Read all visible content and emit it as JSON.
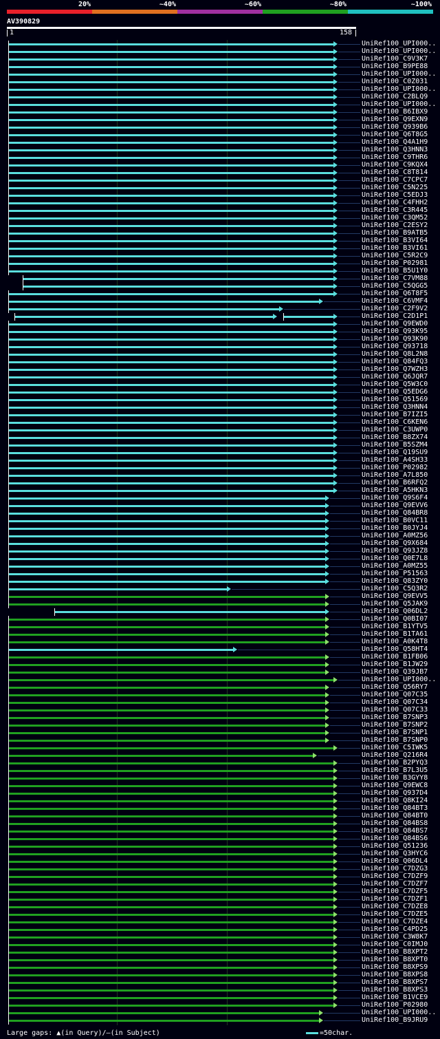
{
  "legend": {
    "labels": [
      "20%",
      "~40%",
      "~60%",
      "~80%",
      "~100%"
    ],
    "colors": [
      "#e8202a",
      "#e07020",
      "#a030a0",
      "#20a020",
      "#20c0c0"
    ]
  },
  "query": {
    "name": "AV390829",
    "start": "1",
    "end": "158",
    "length": 158
  },
  "footer": {
    "gaps_label": "Large gaps:",
    "gaps_query": "(in Query)/",
    "gaps_subject": "(in Subject)",
    "scale_label": "=50char."
  },
  "colors": {
    "cyan": "#5adede",
    "green": "#20a020",
    "background": "#000010"
  },
  "hits": [
    {
      "label": "UniRef100_UPI000..",
      "start": 1,
      "end": 158,
      "color": "cyan"
    },
    {
      "label": "UniRef100_UPI000..",
      "start": 1,
      "end": 158,
      "color": "cyan"
    },
    {
      "label": "UniRef100_C9V3K7",
      "start": 1,
      "end": 158,
      "color": "cyan"
    },
    {
      "label": "UniRef100_B9PE88",
      "start": 1,
      "end": 158,
      "color": "cyan"
    },
    {
      "label": "UniRef100_UPI000..",
      "start": 1,
      "end": 158,
      "color": "cyan"
    },
    {
      "label": "UniRef100_C0Z031",
      "start": 1,
      "end": 158,
      "color": "cyan"
    },
    {
      "label": "UniRef100_UPI000..",
      "start": 1,
      "end": 158,
      "color": "cyan"
    },
    {
      "label": "UniRef100_C2BLQ9",
      "start": 1,
      "end": 158,
      "color": "cyan"
    },
    {
      "label": "UniRef100_UPI000..",
      "start": 1,
      "end": 158,
      "color": "cyan"
    },
    {
      "label": "UniRef100_B6IBX9",
      "start": 1,
      "end": 158,
      "color": "cyan"
    },
    {
      "label": "UniRef100_Q9EXN9",
      "start": 1,
      "end": 158,
      "color": "cyan"
    },
    {
      "label": "UniRef100_Q939B6",
      "start": 1,
      "end": 158,
      "color": "cyan"
    },
    {
      "label": "UniRef100_Q6T8G5",
      "start": 1,
      "end": 158,
      "color": "cyan"
    },
    {
      "label": "UniRef100_Q4A1H9",
      "start": 1,
      "end": 158,
      "color": "cyan"
    },
    {
      "label": "UniRef100_Q3HNN3",
      "start": 1,
      "end": 158,
      "color": "cyan"
    },
    {
      "label": "UniRef100_C9THR6",
      "start": 1,
      "end": 158,
      "color": "cyan"
    },
    {
      "label": "UniRef100_C9KQX4",
      "start": 1,
      "end": 158,
      "color": "cyan"
    },
    {
      "label": "UniRef100_C8T814",
      "start": 1,
      "end": 158,
      "color": "cyan"
    },
    {
      "label": "UniRef100_C7CPC7",
      "start": 1,
      "end": 158,
      "color": "cyan"
    },
    {
      "label": "UniRef100_C5N225",
      "start": 1,
      "end": 158,
      "color": "cyan"
    },
    {
      "label": "UniRef100_C5EDJ3",
      "start": 1,
      "end": 158,
      "color": "cyan"
    },
    {
      "label": "UniRef100_C4FHH2",
      "start": 1,
      "end": 158,
      "color": "cyan"
    },
    {
      "label": "UniRef100_C3R445",
      "start": 1,
      "end": 158,
      "color": "cyan"
    },
    {
      "label": "UniRef100_C3QM52",
      "start": 1,
      "end": 158,
      "color": "cyan"
    },
    {
      "label": "UniRef100_C2ESY2",
      "start": 1,
      "end": 158,
      "color": "cyan"
    },
    {
      "label": "UniRef100_B9ATB5",
      "start": 1,
      "end": 158,
      "color": "cyan"
    },
    {
      "label": "UniRef100_B3VI64",
      "start": 1,
      "end": 158,
      "color": "cyan"
    },
    {
      "label": "UniRef100_B3VI61",
      "start": 1,
      "end": 158,
      "color": "cyan"
    },
    {
      "label": "UniRef100_C5R2C9",
      "start": 1,
      "end": 158,
      "color": "cyan"
    },
    {
      "label": "UniRef100_P02981",
      "start": 1,
      "end": 158,
      "color": "cyan"
    },
    {
      "label": "UniRef100_B5U1Y0",
      "start": 1,
      "end": 158,
      "color": "cyan"
    },
    {
      "label": "UniRef100_C7VM88",
      "start": 8,
      "end": 158,
      "color": "cyan"
    },
    {
      "label": "UniRef100_C5QGG5",
      "start": 8,
      "end": 158,
      "color": "cyan"
    },
    {
      "label": "UniRef100_Q6T8F5",
      "start": 1,
      "end": 158,
      "color": "cyan"
    },
    {
      "label": "UniRef100_C6VMF4",
      "start": 1,
      "end": 151,
      "color": "cyan"
    },
    {
      "label": "UniRef100_C2F9V2",
      "start": 1,
      "end": 132,
      "color": "cyan"
    },
    {
      "label": "UniRef100_C2D1P1",
      "start": 4,
      "end": 158,
      "color": "cyan",
      "gap": [
        129,
        133
      ]
    },
    {
      "label": "UniRef100_Q9EWD0",
      "start": 1,
      "end": 158,
      "color": "cyan"
    },
    {
      "label": "UniRef100_Q93K95",
      "start": 1,
      "end": 158,
      "color": "cyan"
    },
    {
      "label": "UniRef100_Q93K90",
      "start": 1,
      "end": 158,
      "color": "cyan"
    },
    {
      "label": "UniRef100_Q93718",
      "start": 1,
      "end": 158,
      "color": "cyan"
    },
    {
      "label": "UniRef100_Q8L2N8",
      "start": 1,
      "end": 158,
      "color": "cyan"
    },
    {
      "label": "UniRef100_Q84FQ3",
      "start": 1,
      "end": 158,
      "color": "cyan"
    },
    {
      "label": "UniRef100_Q7WZH3",
      "start": 1,
      "end": 158,
      "color": "cyan"
    },
    {
      "label": "UniRef100_Q6JQR7",
      "start": 1,
      "end": 158,
      "color": "cyan"
    },
    {
      "label": "UniRef100_Q5W3C0",
      "start": 1,
      "end": 158,
      "color": "cyan"
    },
    {
      "label": "UniRef100_Q5EDG6",
      "start": 1,
      "end": 158,
      "color": "cyan"
    },
    {
      "label": "UniRef100_Q51569",
      "start": 1,
      "end": 158,
      "color": "cyan"
    },
    {
      "label": "UniRef100_Q3HNN4",
      "start": 1,
      "end": 158,
      "color": "cyan"
    },
    {
      "label": "UniRef100_B7IZI5",
      "start": 1,
      "end": 158,
      "color": "cyan"
    },
    {
      "label": "UniRef100_C6KEN6",
      "start": 1,
      "end": 158,
      "color": "cyan"
    },
    {
      "label": "UniRef100_C3UWP0",
      "start": 1,
      "end": 158,
      "color": "cyan"
    },
    {
      "label": "UniRef100_B8ZX74",
      "start": 1,
      "end": 158,
      "color": "cyan"
    },
    {
      "label": "UniRef100_B5SZM4",
      "start": 1,
      "end": 158,
      "color": "cyan"
    },
    {
      "label": "UniRef100_Q19SU9",
      "start": 1,
      "end": 158,
      "color": "cyan"
    },
    {
      "label": "UniRef100_A4SH33",
      "start": 1,
      "end": 158,
      "color": "cyan"
    },
    {
      "label": "UniRef100_P02982",
      "start": 1,
      "end": 158,
      "color": "cyan"
    },
    {
      "label": "UniRef100_A7L850",
      "start": 1,
      "end": 158,
      "color": "cyan"
    },
    {
      "label": "UniRef100_B6RFQ2",
      "start": 1,
      "end": 158,
      "color": "cyan"
    },
    {
      "label": "UniRef100_A5HKN3",
      "start": 1,
      "end": 158,
      "color": "cyan"
    },
    {
      "label": "UniRef100_Q9S6F4",
      "start": 1,
      "end": 154,
      "color": "cyan"
    },
    {
      "label": "UniRef100_Q9EVV6",
      "start": 1,
      "end": 154,
      "color": "cyan"
    },
    {
      "label": "UniRef100_Q84BR8",
      "start": 1,
      "end": 154,
      "color": "cyan"
    },
    {
      "label": "UniRef100_B0VC11",
      "start": 1,
      "end": 154,
      "color": "cyan"
    },
    {
      "label": "UniRef100_B0JYJ4",
      "start": 1,
      "end": 154,
      "color": "cyan"
    },
    {
      "label": "UniRef100_A0MZ56",
      "start": 1,
      "end": 154,
      "color": "cyan"
    },
    {
      "label": "UniRef100_Q9X684",
      "start": 1,
      "end": 154,
      "color": "cyan"
    },
    {
      "label": "UniRef100_Q93JZ8",
      "start": 1,
      "end": 154,
      "color": "cyan"
    },
    {
      "label": "UniRef100_Q0E7L8",
      "start": 1,
      "end": 154,
      "color": "cyan"
    },
    {
      "label": "UniRef100_A0MZ55",
      "start": 1,
      "end": 154,
      "color": "cyan"
    },
    {
      "label": "UniRef100_P51563",
      "start": 1,
      "end": 154,
      "color": "cyan"
    },
    {
      "label": "UniRef100_Q83ZY0",
      "start": 1,
      "end": 154,
      "color": "cyan"
    },
    {
      "label": "UniRef100_C5Q3R2",
      "start": 1,
      "end": 107,
      "color": "cyan"
    },
    {
      "label": "UniRef100_Q9EVV5",
      "start": 1,
      "end": 154,
      "color": "green"
    },
    {
      "label": "UniRef100_Q5JAK9",
      "start": 1,
      "end": 154,
      "color": "green"
    },
    {
      "label": "UniRef100_Q06DL2",
      "start": 23,
      "end": 154,
      "color": "cyan"
    },
    {
      "label": "UniRef100_Q0BI07",
      "start": 1,
      "end": 154,
      "color": "green"
    },
    {
      "label": "UniRef100_B1YTV5",
      "start": 1,
      "end": 154,
      "color": "green"
    },
    {
      "label": "UniRef100_B1TA61",
      "start": 1,
      "end": 154,
      "color": "green"
    },
    {
      "label": "UniRef100_A0K4T8",
      "start": 1,
      "end": 154,
      "color": "green"
    },
    {
      "label": "UniRef100_Q58HT4",
      "start": 1,
      "end": 110,
      "color": "cyan"
    },
    {
      "label": "UniRef100_B1FB06",
      "start": 1,
      "end": 154,
      "color": "green"
    },
    {
      "label": "UniRef100_B1JW29",
      "start": 1,
      "end": 154,
      "color": "green"
    },
    {
      "label": "UniRef100_Q39JB7",
      "start": 1,
      "end": 154,
      "color": "green"
    },
    {
      "label": "UniRef100_UPI000..",
      "start": 1,
      "end": 158,
      "color": "green"
    },
    {
      "label": "UniRef100_Q56RY7",
      "start": 1,
      "end": 154,
      "color": "green"
    },
    {
      "label": "UniRef100_Q07C35",
      "start": 1,
      "end": 154,
      "color": "green"
    },
    {
      "label": "UniRef100_Q07C34",
      "start": 1,
      "end": 154,
      "color": "green"
    },
    {
      "label": "UniRef100_Q07C33",
      "start": 1,
      "end": 154,
      "color": "green"
    },
    {
      "label": "UniRef100_B7SNP3",
      "start": 1,
      "end": 154,
      "color": "green"
    },
    {
      "label": "UniRef100_B7SNP2",
      "start": 1,
      "end": 154,
      "color": "green"
    },
    {
      "label": "UniRef100_B7SNP1",
      "start": 1,
      "end": 154,
      "color": "green"
    },
    {
      "label": "UniRef100_B7SNP0",
      "start": 1,
      "end": 154,
      "color": "green"
    },
    {
      "label": "UniRef100_C5IWK5",
      "start": 1,
      "end": 158,
      "color": "green"
    },
    {
      "label": "UniRef100_Q216R4",
      "start": 1,
      "end": 148,
      "color": "green"
    },
    {
      "label": "UniRef100_B2PYQ3",
      "start": 1,
      "end": 158,
      "color": "green"
    },
    {
      "label": "UniRef100_B7L3U5",
      "start": 1,
      "end": 158,
      "color": "green"
    },
    {
      "label": "UniRef100_B3GYY8",
      "start": 1,
      "end": 158,
      "color": "green"
    },
    {
      "label": "UniRef100_Q9EWC8",
      "start": 1,
      "end": 158,
      "color": "green"
    },
    {
      "label": "UniRef100_Q937D4",
      "start": 1,
      "end": 158,
      "color": "green"
    },
    {
      "label": "UniRef100_Q8KI24",
      "start": 1,
      "end": 158,
      "color": "green"
    },
    {
      "label": "UniRef100_Q84BT3",
      "start": 1,
      "end": 158,
      "color": "green"
    },
    {
      "label": "UniRef100_Q84BT0",
      "start": 1,
      "end": 158,
      "color": "green"
    },
    {
      "label": "UniRef100_Q84BS8",
      "start": 1,
      "end": 158,
      "color": "green"
    },
    {
      "label": "UniRef100_Q84BS7",
      "start": 1,
      "end": 158,
      "color": "green"
    },
    {
      "label": "UniRef100_Q84BS6",
      "start": 1,
      "end": 158,
      "color": "green"
    },
    {
      "label": "UniRef100_Q51236",
      "start": 1,
      "end": 158,
      "color": "green"
    },
    {
      "label": "UniRef100_Q3HYC6",
      "start": 1,
      "end": 158,
      "color": "green"
    },
    {
      "label": "UniRef100_Q06DL4",
      "start": 1,
      "end": 158,
      "color": "green"
    },
    {
      "label": "UniRef100_C7DZG3",
      "start": 1,
      "end": 158,
      "color": "green"
    },
    {
      "label": "UniRef100_C7DZF9",
      "start": 1,
      "end": 158,
      "color": "green"
    },
    {
      "label": "UniRef100_C7DZF7",
      "start": 1,
      "end": 158,
      "color": "green"
    },
    {
      "label": "UniRef100_C7DZF5",
      "start": 1,
      "end": 158,
      "color": "green"
    },
    {
      "label": "UniRef100_C7DZF1",
      "start": 1,
      "end": 158,
      "color": "green"
    },
    {
      "label": "UniRef100_C7DZE8",
      "start": 1,
      "end": 158,
      "color": "green"
    },
    {
      "label": "UniRef100_C7DZE5",
      "start": 1,
      "end": 158,
      "color": "green"
    },
    {
      "label": "UniRef100_C7DZE4",
      "start": 1,
      "end": 158,
      "color": "green"
    },
    {
      "label": "UniRef100_C4PD25",
      "start": 1,
      "end": 158,
      "color": "green"
    },
    {
      "label": "UniRef100_C3W8K7",
      "start": 1,
      "end": 158,
      "color": "green"
    },
    {
      "label": "UniRef100_C0IMJ0",
      "start": 1,
      "end": 158,
      "color": "green"
    },
    {
      "label": "UniRef100_B8XPT2",
      "start": 1,
      "end": 158,
      "color": "green"
    },
    {
      "label": "UniRef100_B8XPT0",
      "start": 1,
      "end": 158,
      "color": "green"
    },
    {
      "label": "UniRef100_B8XPS9",
      "start": 1,
      "end": 158,
      "color": "green"
    },
    {
      "label": "UniRef100_B8XPS8",
      "start": 1,
      "end": 158,
      "color": "green"
    },
    {
      "label": "UniRef100_B8XPS7",
      "start": 1,
      "end": 158,
      "color": "green"
    },
    {
      "label": "UniRef100_B8XPS3",
      "start": 1,
      "end": 158,
      "color": "green"
    },
    {
      "label": "UniRef100_B1VCE9",
      "start": 1,
      "end": 158,
      "color": "green"
    },
    {
      "label": "UniRef100_P02980",
      "start": 1,
      "end": 158,
      "color": "green"
    },
    {
      "label": "UniRef100_UPI000..",
      "start": 1,
      "end": 151,
      "color": "green"
    },
    {
      "label": "UniRef100_B9JRU9",
      "start": 1,
      "end": 151,
      "color": "green"
    }
  ]
}
